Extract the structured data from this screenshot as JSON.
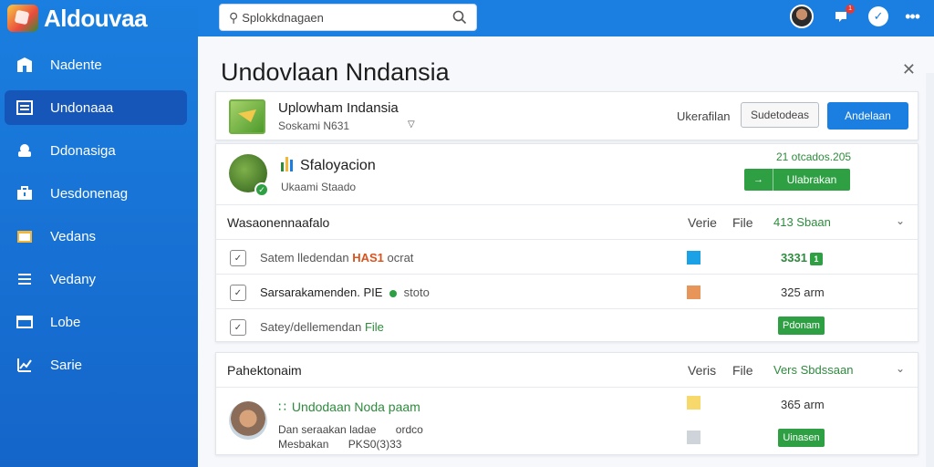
{
  "app": {
    "name": "Aldouvaa"
  },
  "search": {
    "value": "Splokkdnagaen"
  },
  "sidebar": {
    "items": [
      {
        "label": "Nadente",
        "icon": "building-icon"
      },
      {
        "label": "Undonaaa",
        "icon": "list-icon"
      },
      {
        "label": "Ddonasiga",
        "icon": "cloud-icon"
      },
      {
        "label": "Uesdonenag",
        "icon": "briefcase-icon"
      },
      {
        "label": "Vedans",
        "icon": "folder-icon"
      },
      {
        "label": "Vedany",
        "icon": "menu-icon"
      },
      {
        "label": "Lobe",
        "icon": "window-icon"
      },
      {
        "label": "Sarie",
        "icon": "chart-icon"
      }
    ]
  },
  "header": {
    "notification_count": "1"
  },
  "page": {
    "title": "Undovlaan Nndansia"
  },
  "app_card": {
    "name": "Uplowham Indansia",
    "subtitle": "Soskami N631",
    "label": "Ukerafilan",
    "outline_button": "Sudetodeas",
    "primary_button": "Andelaan"
  },
  "status": {
    "title": "Sfaloyacion",
    "subtitle": "Ukaami Staado",
    "date": "21 otcados.205",
    "button": "Ulabrakan"
  },
  "section1": {
    "title": "Wasaonennaafalo",
    "col1": "Verie",
    "col2": "File",
    "col3": "413 Sbaan",
    "rows": [
      {
        "text": "Satem lledendan",
        "tag": "HAS1",
        "tail": "ocrat",
        "color": "#1aa1e6",
        "value": "3331",
        "badge": "1"
      },
      {
        "text": "Sarsarakamenden. PIE",
        "tail": "stoto",
        "color": "#e8955a",
        "value": "325 arm"
      },
      {
        "text": "Satey/dellemendan",
        "tag": "File",
        "color": "#ffffff",
        "value_pill": "Pdonam"
      }
    ]
  },
  "section2": {
    "title": "Pahektonaim",
    "col1": "Veris",
    "col2": "File",
    "col3": "Vers Sbdssaan",
    "item": {
      "title": "Undodaan Noda paam",
      "line1a": "Dan seraakan",
      "line1b": "ladae",
      "line1c": "ordco",
      "line2a": "Mesbakan",
      "line2b": "PKS0(3)33",
      "value": "365 arm",
      "pill": "Uinasen"
    }
  }
}
